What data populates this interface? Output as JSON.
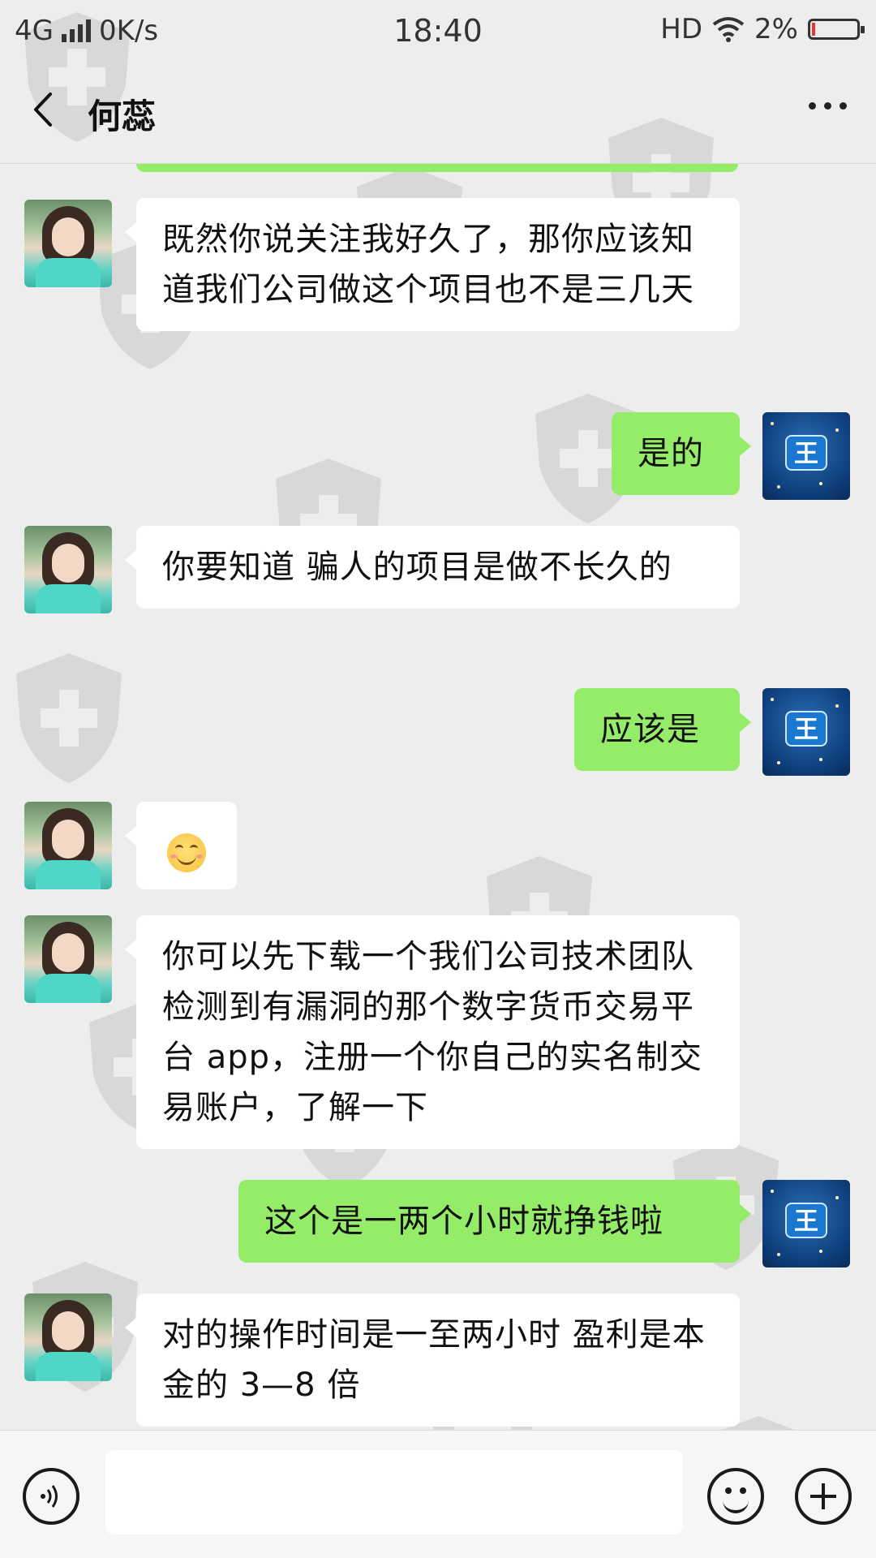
{
  "status_bar": {
    "network": "4G",
    "speed": "0K/s",
    "time": "18:40",
    "hd": "HD",
    "battery": "2%"
  },
  "header": {
    "title": "何蕊",
    "back_icon": "chevron-left-icon",
    "more_icon": "more-dots-icon"
  },
  "messages": [
    {
      "from": "other",
      "text": "既然你说关注我好久了，那你应该知道我们公司做这个项目也不是三几天"
    },
    {
      "from": "self",
      "text": "是的",
      "avatar_text": "王"
    },
    {
      "from": "other",
      "text": "你要知道 骗人的项目是做不长久的"
    },
    {
      "from": "self",
      "text": "应该是",
      "avatar_text": "王"
    },
    {
      "from": "other",
      "emoji": "smiling-face-emoji"
    },
    {
      "from": "other",
      "text": "你可以先下载一个我们公司技术团队检测到有漏洞的那个数字货币交易平台 app，注册一个你自己的实名制交易账户，了解一下"
    },
    {
      "from": "self",
      "text": "这个是一两个小时就挣钱啦",
      "avatar_text": "王"
    },
    {
      "from": "other",
      "text": "对的操作时间是一至两小时 盈利是本金的 3—8 倍"
    }
  ],
  "colors": {
    "background": "#ededed",
    "self_bubble": "#95ec69",
    "other_bubble": "#ffffff"
  },
  "input_bar": {
    "voice_icon": "voice-icon",
    "emoji_icon": "emoji-icon",
    "plus_icon": "plus-icon",
    "input_value": ""
  }
}
